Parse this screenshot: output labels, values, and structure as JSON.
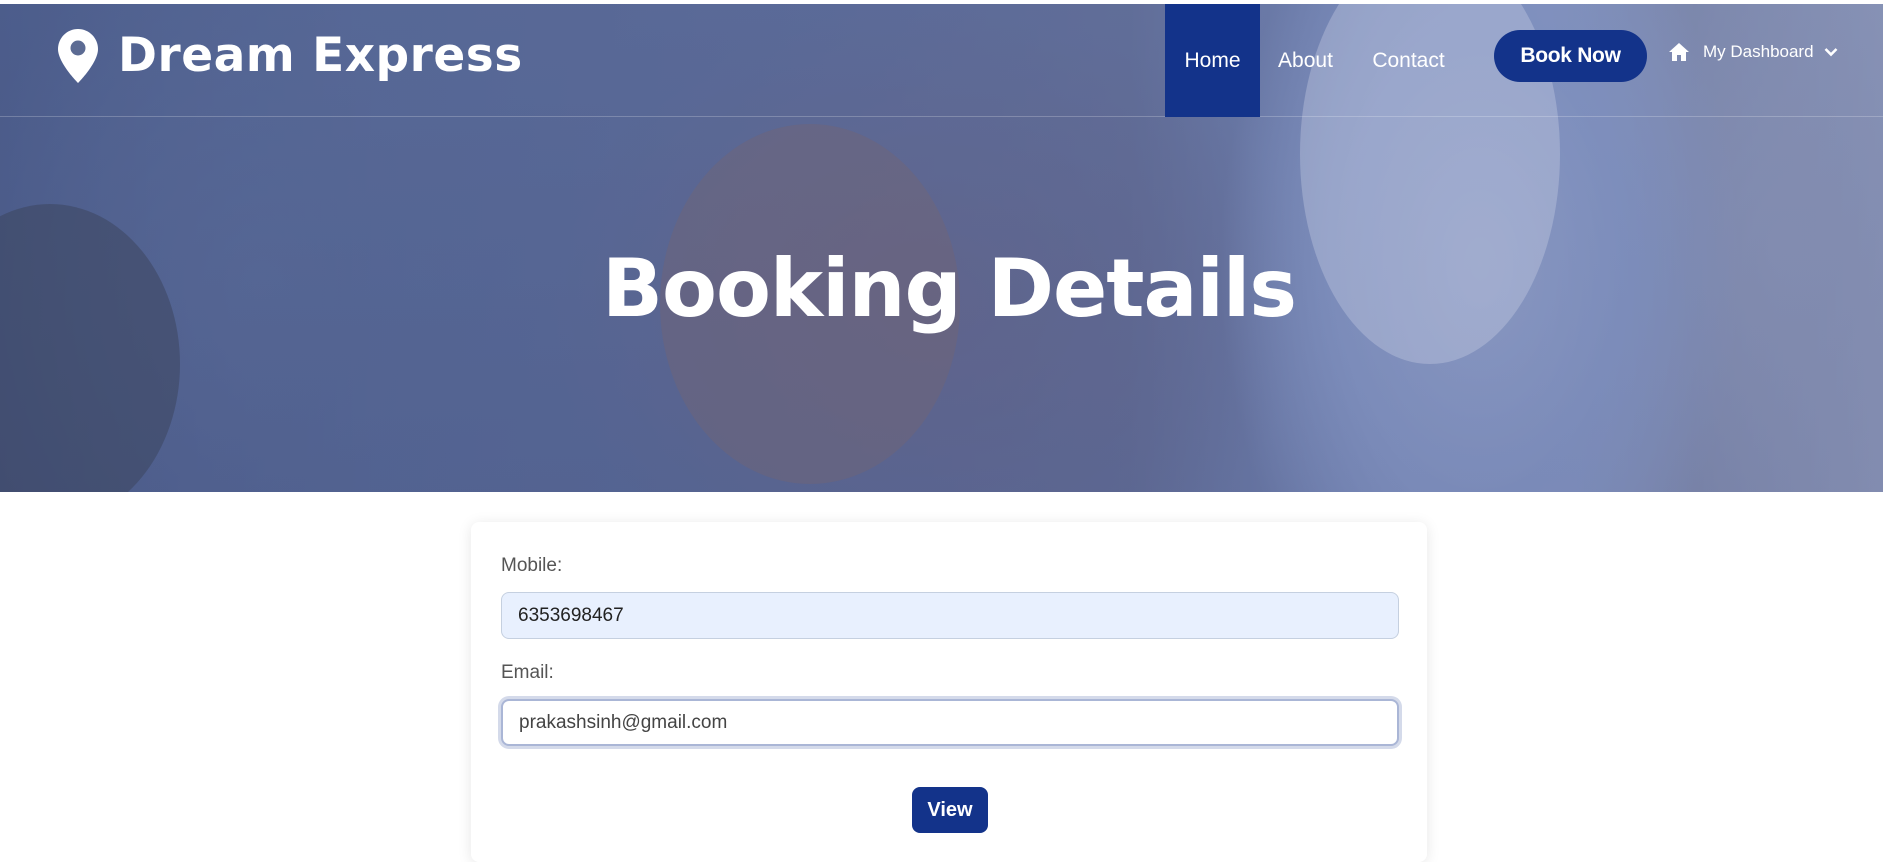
{
  "brand": {
    "name": "Dream Express",
    "icon": "map-pin-icon"
  },
  "nav": {
    "items": [
      {
        "label": "Home",
        "active": true
      },
      {
        "label": "About",
        "active": false
      },
      {
        "label": "Contact",
        "active": false
      }
    ],
    "book_label": "Book Now",
    "dashboard_label": "My Dashboard",
    "dashboard_icon": "home-icon"
  },
  "hero": {
    "title": "Booking Details"
  },
  "form": {
    "mobile_label": "Mobile:",
    "mobile_value": "6353698467",
    "email_label": "Email:",
    "email_value": "prakashsinh@gmail.com",
    "submit_label": "View"
  },
  "colors": {
    "accent": "#13338a",
    "autofill_bg": "#e8f0fe"
  }
}
